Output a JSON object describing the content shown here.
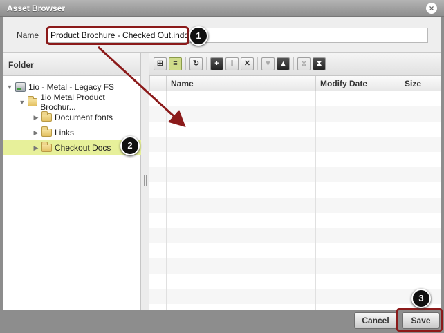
{
  "window": {
    "title": "Asset Browser",
    "close_icon": "close-icon"
  },
  "name_field": {
    "label": "Name",
    "value": "Product Brochure - Checked Out.indd"
  },
  "folder_pane": {
    "header": "Folder",
    "items": [
      {
        "label": "1io - Metal - Legacy FS",
        "icon": "server-icon",
        "expanded": true
      },
      {
        "label": "1io Metal Product Brochur...",
        "icon": "folder-icon",
        "expanded": true
      },
      {
        "label": "Document fonts",
        "icon": "folder-icon",
        "expanded": false
      },
      {
        "label": "Links",
        "icon": "folder-icon",
        "expanded": false
      },
      {
        "label": "Checkout Docs",
        "icon": "folder-icon",
        "expanded": false,
        "selected": true
      }
    ]
  },
  "toolbar": {
    "buttons": [
      {
        "name": "thumbnail-view-icon",
        "glyph": "⊞"
      },
      {
        "name": "list-view-icon",
        "glyph": "≡"
      },
      {
        "name": "refresh-icon",
        "glyph": "↻"
      },
      {
        "name": "new-folder-icon",
        "glyph": "+"
      },
      {
        "name": "info-icon",
        "glyph": "i"
      },
      {
        "name": "delete-icon",
        "glyph": "✕"
      },
      {
        "name": "folder-down-icon",
        "glyph": "▾"
      },
      {
        "name": "folder-up-icon",
        "glyph": "▴"
      },
      {
        "name": "checkout-icon",
        "glyph": "⧖"
      },
      {
        "name": "checkin-icon",
        "glyph": "⧗"
      }
    ]
  },
  "file_grid": {
    "columns": [
      "Name",
      "Modify Date",
      "Size"
    ],
    "rows": []
  },
  "footer": {
    "cancel_label": "Cancel",
    "save_label": "Save"
  },
  "annotations": {
    "badge_1": "1",
    "badge_2": "2",
    "badge_3": "3"
  },
  "colors": {
    "selection": "#e7f09a",
    "callout": "#8b1a1a"
  }
}
